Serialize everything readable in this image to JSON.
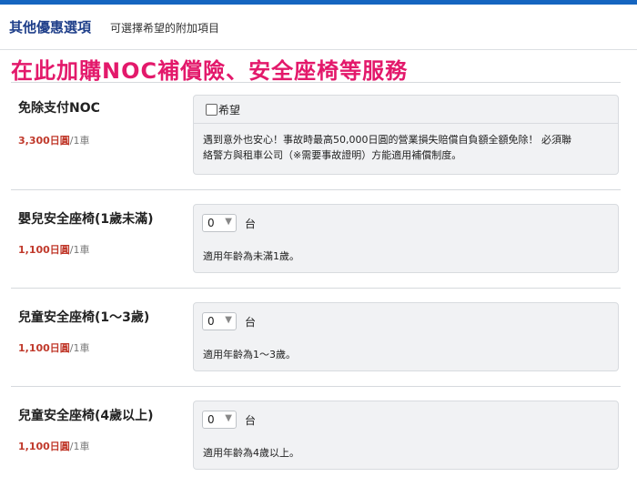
{
  "header": {
    "title": "其他優惠選項",
    "subtitle": "可選擇希望的附加項目"
  },
  "banner": "在此加購NOC補償險、安全座椅等服務",
  "items": [
    {
      "name": "免除支付NOC",
      "price": "3,300日圓",
      "price_unit": "/1車",
      "checkbox_label": "希望",
      "checked": false,
      "desc_line1": "遇到意外也安心！事故時最高50,000日圓的營業損失賠償自負額全額免除！ 必須聯",
      "desc_line2": "絡警方與租車公司（※需要事故證明）方能適用補償制度。"
    },
    {
      "name": "嬰兒安全座椅(1歲未滿)",
      "price": "1,100日圓",
      "price_unit": "/1車",
      "qty": "0",
      "qty_unit": "台",
      "desc": "適用年齡為未滿1歲。"
    },
    {
      "name": "兒童安全座椅(1～3歲)",
      "price": "1,100日圓",
      "price_unit": "/1車",
      "qty": "0",
      "qty_unit": "台",
      "desc": "適用年齡為1～3歲。"
    },
    {
      "name": "兒童安全座椅(4歲以上)",
      "price": "1,100日圓",
      "price_unit": "/1車",
      "qty": "0",
      "qty_unit": "台",
      "desc": "適用年齡為4歲以上。"
    }
  ],
  "colors": {
    "accent": "#1565c0",
    "title": "#1f3f8a",
    "banner": "#e3196b",
    "price": "#c0392b"
  }
}
